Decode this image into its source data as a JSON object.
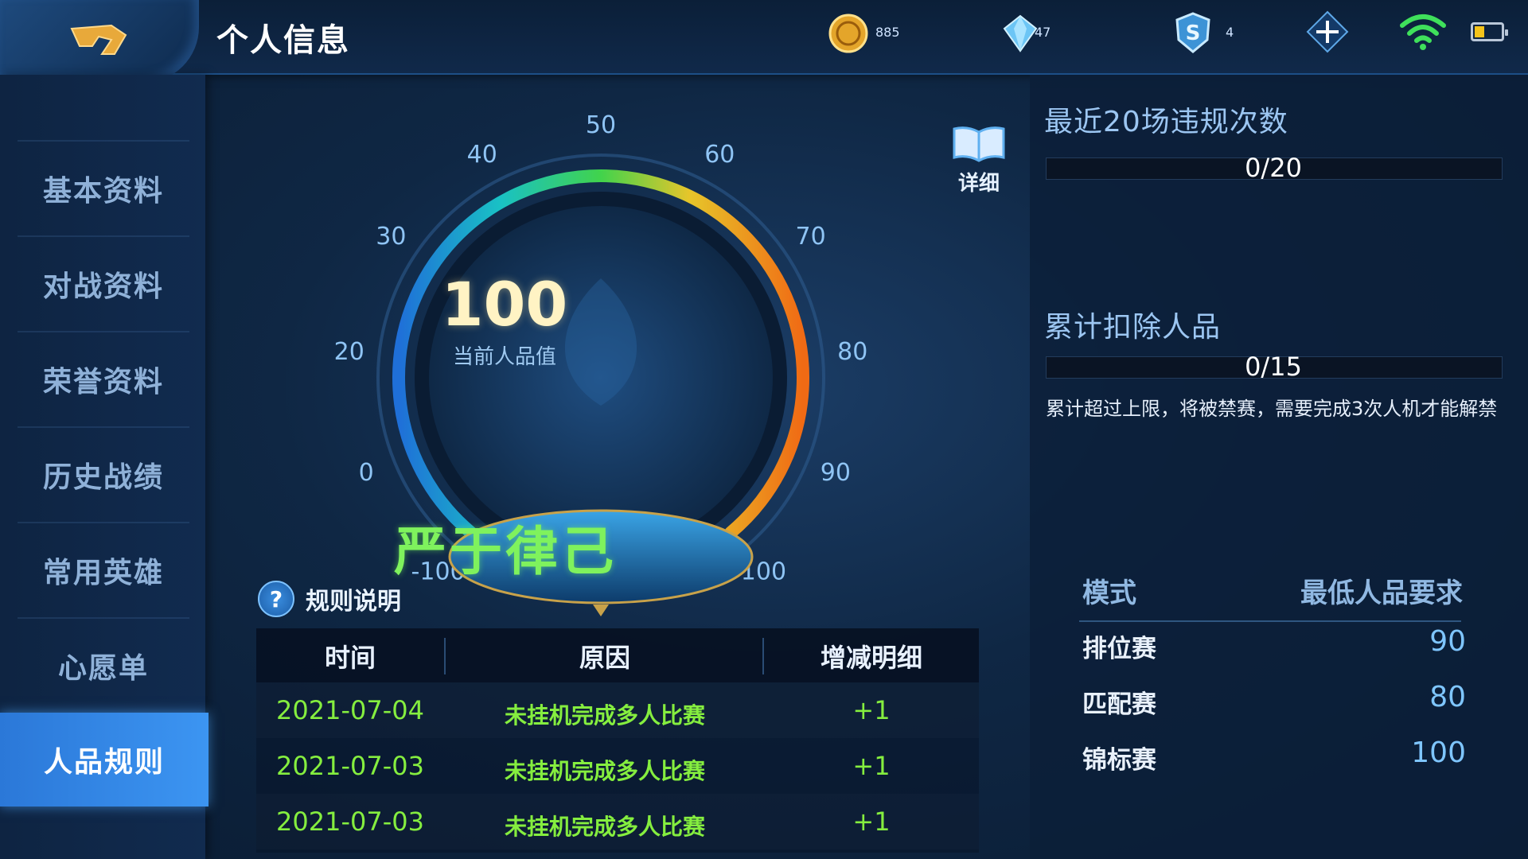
{
  "header": {
    "title": "个人信息",
    "currencies": [
      {
        "name": "gold",
        "icon": "gold-coin-icon",
        "value": "885"
      },
      {
        "name": "diamond",
        "icon": "diamond-icon",
        "value": "47"
      },
      {
        "name": "voucher",
        "icon": "voucher-icon",
        "value": "4"
      }
    ],
    "battery_level": 0.35
  },
  "sidebar": {
    "items": [
      {
        "label": "基本资料"
      },
      {
        "label": "对战资料"
      },
      {
        "label": "荣誉资料"
      },
      {
        "label": "历史战绩"
      },
      {
        "label": "常用英雄"
      },
      {
        "label": "心愿单"
      },
      {
        "label": "人品规则",
        "active": true
      }
    ]
  },
  "gauge": {
    "ticks": [
      "-100",
      "0",
      "20",
      "30",
      "40",
      "50",
      "60",
      "70",
      "80",
      "90",
      "100"
    ],
    "score": "100",
    "score_label": "当前人品值",
    "rank_title": "严于律己",
    "detail_label": "详细",
    "rules_label": "规则说明",
    "help_glyph": "?"
  },
  "records": {
    "columns": [
      "时间",
      "原因",
      "增减明细"
    ],
    "rows": [
      {
        "date": "2021-07-04",
        "reason": "未挂机完成多人比赛",
        "delta": "+1"
      },
      {
        "date": "2021-07-03",
        "reason": "未挂机完成多人比赛",
        "delta": "+1"
      },
      {
        "date": "2021-07-03",
        "reason": "未挂机完成多人比赛",
        "delta": "+1"
      }
    ]
  },
  "right_panel": {
    "violations_title": "最近20场违规次数",
    "violations_value": "0/20",
    "violations_fraction": 0,
    "deduction_title": "累计扣除人品",
    "deduction_value": "0/15",
    "deduction_fraction": 0,
    "deduction_note": "累计超过上限，将被禁赛，需要完成3次人机才能解禁",
    "req_columns": [
      "模式",
      "最低人品要求"
    ],
    "requirements": [
      {
        "mode": "排位赛",
        "min": "90"
      },
      {
        "mode": "匹配赛",
        "min": "80"
      },
      {
        "mode": "锦标赛",
        "min": "100"
      }
    ]
  },
  "colors": {
    "accent_green": "#7ff25d",
    "record_green": "#85ee3f",
    "active_tab": "#2b78d8",
    "score_gold": "#fff3c4"
  }
}
